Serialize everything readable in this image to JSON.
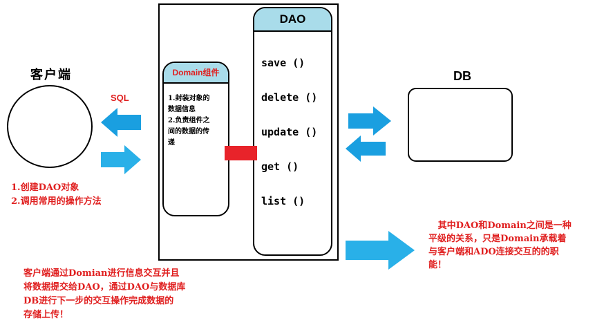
{
  "client": {
    "label": "客户端",
    "protocol_label": "SQL",
    "notes": [
      "1.创建DAO对象",
      "2.调用常用的操作方法"
    ]
  },
  "domain": {
    "title": "Domain组件",
    "lines": [
      "1.封装对象的",
      "数据信息",
      "2.负责组件之",
      "间的数据的传",
      "递"
    ]
  },
  "dao": {
    "title": "DAO",
    "methods": [
      "save ()",
      "delete ()",
      "update ()",
      "get ()",
      "list ()"
    ]
  },
  "db": {
    "label": "DB"
  },
  "bottom_note": {
    "lines": [
      "客户端通过Domian进行信息交互并且",
      "将数据提交给DAO，通过DAO与数据库",
      "DB进行下一步的交互操作完成数据的",
      "存储上传！"
    ]
  },
  "right_note": {
    "lines": [
      "   其中DAO和Domain之间是一种",
      "平级的关系，只是Domain承载着",
      "与客户端和ADO连接交互的的职",
      "能！"
    ]
  },
  "colors": {
    "arrow_fill": "#1a9fe0",
    "header_fill": "#a9dcea",
    "note_text": "#e02020",
    "connector": "#e8232a"
  }
}
